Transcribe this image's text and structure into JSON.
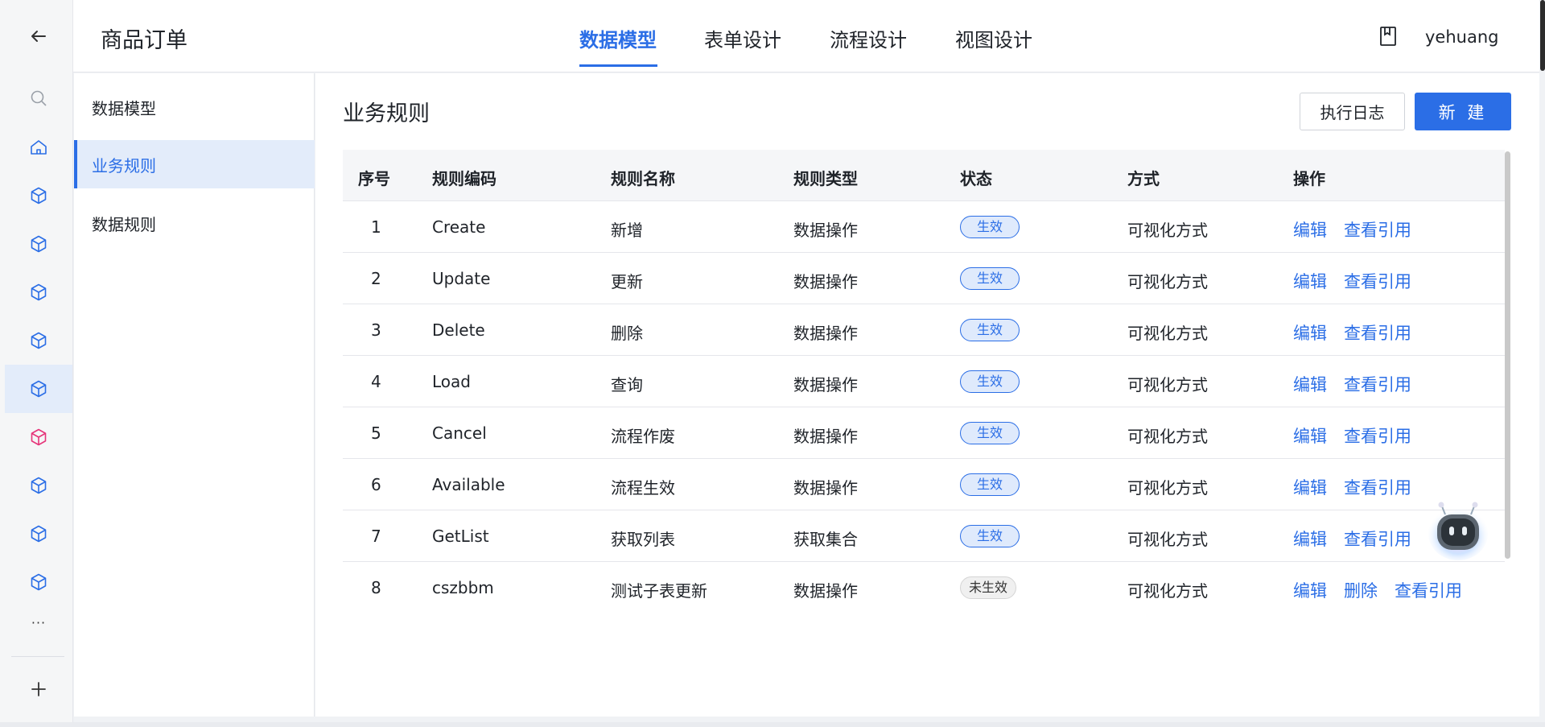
{
  "header": {
    "app_title": "商品订单",
    "tabs": [
      {
        "label": "数据模型",
        "active": true
      },
      {
        "label": "表单设计",
        "active": false
      },
      {
        "label": "流程设计",
        "active": false
      },
      {
        "label": "视图设计",
        "active": false
      }
    ],
    "user": "yehuang"
  },
  "rail": {
    "more": "···",
    "icons": [
      "back-arrow-icon",
      "search-icon",
      "home-icon",
      "cube-icon",
      "plus-icon"
    ]
  },
  "sidebar": {
    "items": [
      {
        "label": "数据模型"
      },
      {
        "label": "业务规则",
        "active": true
      },
      {
        "label": "数据规则"
      }
    ]
  },
  "main": {
    "title": "业务规则",
    "log_button": "执行日志",
    "new_button": "新 建"
  },
  "table": {
    "headers": [
      "序号",
      "规则编码",
      "规则名称",
      "规则类型",
      "状态",
      "方式",
      "操作"
    ],
    "rows": [
      {
        "no": "1",
        "code": "Create",
        "name": "新增",
        "type": "数据操作",
        "status": "生效",
        "mode": "可视化方式",
        "ops": [
          "编辑",
          "查看引用"
        ]
      },
      {
        "no": "2",
        "code": "Update",
        "name": "更新",
        "type": "数据操作",
        "status": "生效",
        "mode": "可视化方式",
        "ops": [
          "编辑",
          "查看引用"
        ]
      },
      {
        "no": "3",
        "code": "Delete",
        "name": "删除",
        "type": "数据操作",
        "status": "生效",
        "mode": "可视化方式",
        "ops": [
          "编辑",
          "查看引用"
        ]
      },
      {
        "no": "4",
        "code": "Load",
        "name": "查询",
        "type": "数据操作",
        "status": "生效",
        "mode": "可视化方式",
        "ops": [
          "编辑",
          "查看引用"
        ]
      },
      {
        "no": "5",
        "code": "Cancel",
        "name": "流程作废",
        "type": "数据操作",
        "status": "生效",
        "mode": "可视化方式",
        "ops": [
          "编辑",
          "查看引用"
        ]
      },
      {
        "no": "6",
        "code": "Available",
        "name": "流程生效",
        "type": "数据操作",
        "status": "生效",
        "mode": "可视化方式",
        "ops": [
          "编辑",
          "查看引用"
        ]
      },
      {
        "no": "7",
        "code": "GetList",
        "name": "获取列表",
        "type": "获取集合",
        "status": "生效",
        "mode": "可视化方式",
        "ops": [
          "编辑",
          "查看引用"
        ]
      },
      {
        "no": "8",
        "code": "cszbbm",
        "name": "测试子表更新",
        "type": "数据操作",
        "status": "未生效",
        "mode": "可视化方式",
        "ops": [
          "编辑",
          "删除",
          "查看引用"
        ]
      }
    ]
  },
  "colors": {
    "accent": "#2b6ee6",
    "cube_highlight": "#e6357a"
  }
}
